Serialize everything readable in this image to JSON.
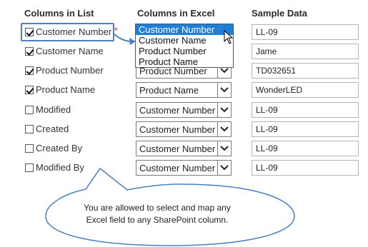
{
  "headers": {
    "list": "Columns in List",
    "excel": "Columns in Excel",
    "sample": "Sample Data"
  },
  "required_mark": "*",
  "rows": [
    {
      "label": "Customer Number",
      "checked": true,
      "excel": "Customer Number",
      "sample": "LL-09"
    },
    {
      "label": "Customer Name",
      "checked": true,
      "excel": "Customer Name",
      "sample": "Jame"
    },
    {
      "label": "Product Number",
      "checked": true,
      "excel": "Product Number",
      "sample": "TD032651"
    },
    {
      "label": "Product Name",
      "checked": true,
      "excel": "Product Name",
      "sample": "WonderLED"
    },
    {
      "label": "Modified",
      "checked": false,
      "excel": "Customer Number",
      "sample": "LL-09"
    },
    {
      "label": "Created",
      "checked": false,
      "excel": "Customer Number",
      "sample": "LL-09"
    },
    {
      "label": "Created By",
      "checked": false,
      "excel": "Customer Number",
      "sample": "LL-09"
    },
    {
      "label": "Modified By",
      "checked": false,
      "excel": "Customer Number",
      "sample": "LL-09"
    }
  ],
  "dropdown": {
    "options": [
      "Customer Number",
      "Customer Name",
      "Product Number",
      "Product Name"
    ],
    "selected_index": 0
  },
  "callout": {
    "line1": "You are allowed to select and map any",
    "line2": "Excel field to any SharePoint column."
  },
  "colors": {
    "highlight": "#4a7fc1",
    "selected_option": "#1e7fd6",
    "required": "#c62828"
  }
}
